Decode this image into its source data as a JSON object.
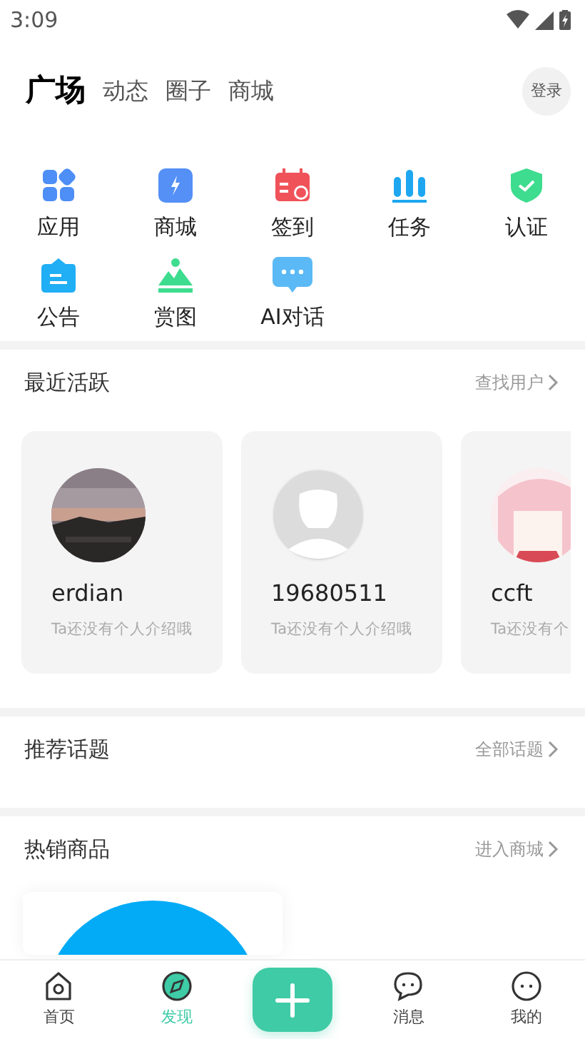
{
  "status_bar": {
    "time": "3:09"
  },
  "tabs": [
    {
      "label": "广场",
      "selected": true
    },
    {
      "label": "动态",
      "selected": false
    },
    {
      "label": "圈子",
      "selected": false
    },
    {
      "label": "商城",
      "selected": false
    }
  ],
  "login_button": "登录",
  "shortcuts": [
    {
      "label": "应用",
      "kind": "apps"
    },
    {
      "label": "商城",
      "kind": "shop"
    },
    {
      "label": "签到",
      "kind": "checkin"
    },
    {
      "label": "任务",
      "kind": "tasks"
    },
    {
      "label": "认证",
      "kind": "verify"
    },
    {
      "label": "公告",
      "kind": "notice"
    },
    {
      "label": "赏图",
      "kind": "gallery"
    },
    {
      "label": "AI对话",
      "kind": "chat"
    }
  ],
  "recent": {
    "title": "最近活跃",
    "link": "查找用户",
    "users": [
      {
        "name": "erdian",
        "bio": "Ta还没有个人介绍哦",
        "kind": "picture"
      },
      {
        "name": "19680511",
        "bio": "Ta还没有个人介绍哦",
        "kind": "default"
      },
      {
        "name": "ccft",
        "bio": "Ta还没有个",
        "kind": "picture"
      }
    ]
  },
  "topics": {
    "title": "推荐话题",
    "link": "全部话题"
  },
  "products": {
    "title": "热销商品",
    "link": "进入商城"
  },
  "nav": [
    {
      "label": "首页",
      "kind": "home",
      "selected": false
    },
    {
      "label": "发现",
      "kind": "discover",
      "selected": true
    },
    {
      "kind": "add"
    },
    {
      "label": "消息",
      "kind": "messages",
      "selected": false
    },
    {
      "label": "我的",
      "kind": "me",
      "selected": false
    }
  ]
}
